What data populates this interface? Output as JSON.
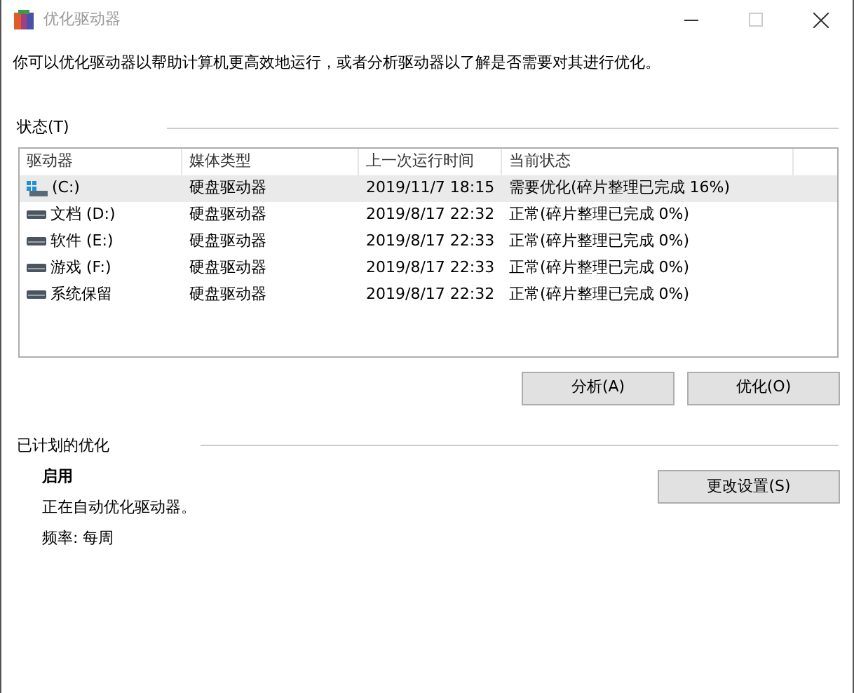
{
  "window": {
    "title": "优化驱动器"
  },
  "description": "你可以优化驱动器以帮助计算机更高效地运行，或者分析驱动器以了解是否需要对其进行优化。",
  "status_section": {
    "label": "状态(T)"
  },
  "table": {
    "columns": [
      "驱动器",
      "媒体类型",
      "上一次运行时间",
      "当前状态"
    ],
    "rows": [
      {
        "kind": "system",
        "cells": [
          "(C:)",
          "硬盘驱动器",
          "2019/11/7 18:15",
          "需要优化(碎片整理已完成 16%)"
        ],
        "selected": true
      },
      {
        "kind": "drive",
        "cells": [
          "文档 (D:)",
          "硬盘驱动器",
          "2019/8/17 22:32",
          "正常(碎片整理已完成 0%)"
        ],
        "selected": false
      },
      {
        "kind": "drive",
        "cells": [
          "软件 (E:)",
          "硬盘驱动器",
          "2019/8/17 22:33",
          "正常(碎片整理已完成 0%)"
        ],
        "selected": false
      },
      {
        "kind": "drive",
        "cells": [
          "游戏 (F:)",
          "硬盘驱动器",
          "2019/8/17 22:33",
          "正常(碎片整理已完成 0%)"
        ],
        "selected": false
      },
      {
        "kind": "drive",
        "cells": [
          "系统保留",
          "硬盘驱动器",
          "2019/8/17 22:32",
          "正常(碎片整理已完成 0%)"
        ],
        "selected": false
      }
    ]
  },
  "actions": [
    "分析(A)",
    "优化(O)"
  ],
  "schedule": {
    "label": "已计划的优化",
    "state": "启用",
    "detail": "正在自动优化驱动器。",
    "frequency": "频率: 每周",
    "button": "更改设置(S)"
  }
}
